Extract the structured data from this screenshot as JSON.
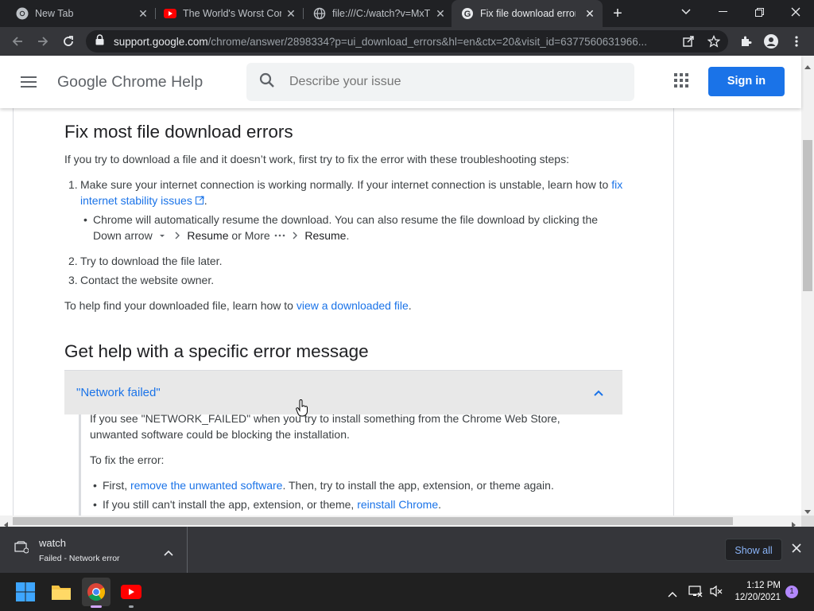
{
  "browser": {
    "tabs": [
      {
        "title": "New Tab",
        "icon": "chrome-icon",
        "active": false
      },
      {
        "title": "The World's Worst Comp",
        "icon": "youtube-icon",
        "active": false
      },
      {
        "title": "file:///C:/watch?v=MxT",
        "icon": "globe-icon",
        "active": false
      },
      {
        "title": "Fix file download errors",
        "icon": "google-icon",
        "active": true
      }
    ],
    "url_host": "support.google.com",
    "url_path": "/chrome/answer/2898334?p=ui_download_errors&hl=en&ctx=20&visit_id=6377560631966..."
  },
  "header": {
    "site_title": "Google Chrome Help",
    "search_placeholder": "Describe your issue",
    "signin_label": "Sign in"
  },
  "article": {
    "heading1": "Fix most file download errors",
    "intro": "If you try to download a file and it doesn’t work, first try to fix the error with these troubleshooting steps:",
    "step1_num": "1.",
    "step1_text": "Make sure your internet connection is working normally. If your internet connection is unstable, learn how to",
    "step1_link": "fix internet stability issues",
    "step1_end": ".",
    "bullet_part1": "Chrome will automatically resume the download. You can also resume the file download by clicking the",
    "bullet_downarrow": "Down arrow",
    "bullet_resume": "Resume",
    "bullet_or": "or",
    "bullet_more": "More",
    "bullet_resume2": "Resume",
    "bullet_period": ".",
    "step2_num": "2.",
    "step2_text": "Try to download the file later.",
    "step3_num": "3.",
    "step3_text": "Contact the website owner.",
    "findfile_text": "To help find your downloaded file, learn how to",
    "findfile_link": "view a downloaded file",
    "findfile_end": ".",
    "heading2": "Get help with a specific error message",
    "accordion_title": "\"Network failed\"",
    "acc_para1a": "If you see \"NETWORK_FAILED\" when you try to install something from the Chrome Web Store,",
    "acc_para1b": "unwanted software could be blocking the installation.",
    "acc_fix": "To fix the error:",
    "acc_b1_a": "First,",
    "acc_b1_link": "remove the unwanted software",
    "acc_b1_b": ". Then, try to install the app, extension, or theme again.",
    "acc_b2_a": "If you still can't install the app, extension, or theme,",
    "acc_b2_link": "reinstall Chrome",
    "acc_b2_b": "."
  },
  "download": {
    "filename": "watch",
    "status": "Failed - Network error",
    "show_all": "Show all"
  },
  "taskbar": {
    "time": "1:12 PM",
    "date": "12/20/2021",
    "notifications": "1"
  }
}
